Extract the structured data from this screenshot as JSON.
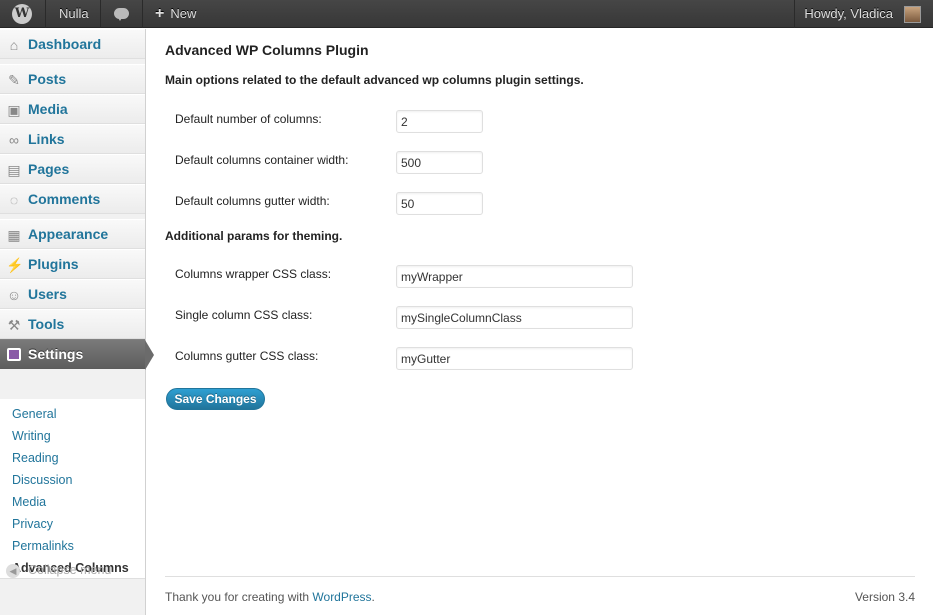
{
  "admin_bar": {
    "logo_glyph": "W",
    "site_name": "Nulla",
    "new_label": "New",
    "howdy": "Howdy, Vladica"
  },
  "sidebar": {
    "items": [
      {
        "label": "Dashboard",
        "icon": "dashboard-icon"
      },
      {
        "label": "Posts",
        "icon": "pin-icon"
      },
      {
        "label": "Media",
        "icon": "media-icon"
      },
      {
        "label": "Links",
        "icon": "link-icon"
      },
      {
        "label": "Pages",
        "icon": "pages-icon"
      },
      {
        "label": "Comments",
        "icon": "comment-icon"
      },
      {
        "label": "Appearance",
        "icon": "appearance-icon"
      },
      {
        "label": "Plugins",
        "icon": "plug-icon"
      },
      {
        "label": "Users",
        "icon": "users-icon"
      },
      {
        "label": "Tools",
        "icon": "tools-icon"
      },
      {
        "label": "Settings",
        "icon": "settings-icon"
      }
    ],
    "submenu": [
      "General",
      "Writing",
      "Reading",
      "Discussion",
      "Media",
      "Privacy",
      "Permalinks",
      "Advanced Columns"
    ],
    "collapse_label": "Collapse menu"
  },
  "main": {
    "title": "Advanced WP Columns Plugin",
    "section1": "Main options related to the default advanced wp columns plugin settings.",
    "fields1": [
      {
        "label": "Default number of columns:",
        "value": "2"
      },
      {
        "label": "Default columns container width:",
        "value": "500"
      },
      {
        "label": "Default columns gutter width:",
        "value": "50"
      }
    ],
    "section2": "Additional params for theming.",
    "fields2": [
      {
        "label": "Columns wrapper CSS class:",
        "value": "myWrapper"
      },
      {
        "label": "Single column CSS class:",
        "value": "mySingleColumnClass"
      },
      {
        "label": "Columns gutter CSS class:",
        "value": "myGutter"
      }
    ],
    "save_label": "Save Changes"
  },
  "footer": {
    "thanks_prefix": "Thank you for creating with ",
    "thanks_link": "WordPress",
    "thanks_suffix": ".",
    "version": "Version 3.4"
  },
  "colors": {
    "accent": "#21759b",
    "admin_bar": "#464646",
    "current_menu": "#6b6b6b"
  }
}
